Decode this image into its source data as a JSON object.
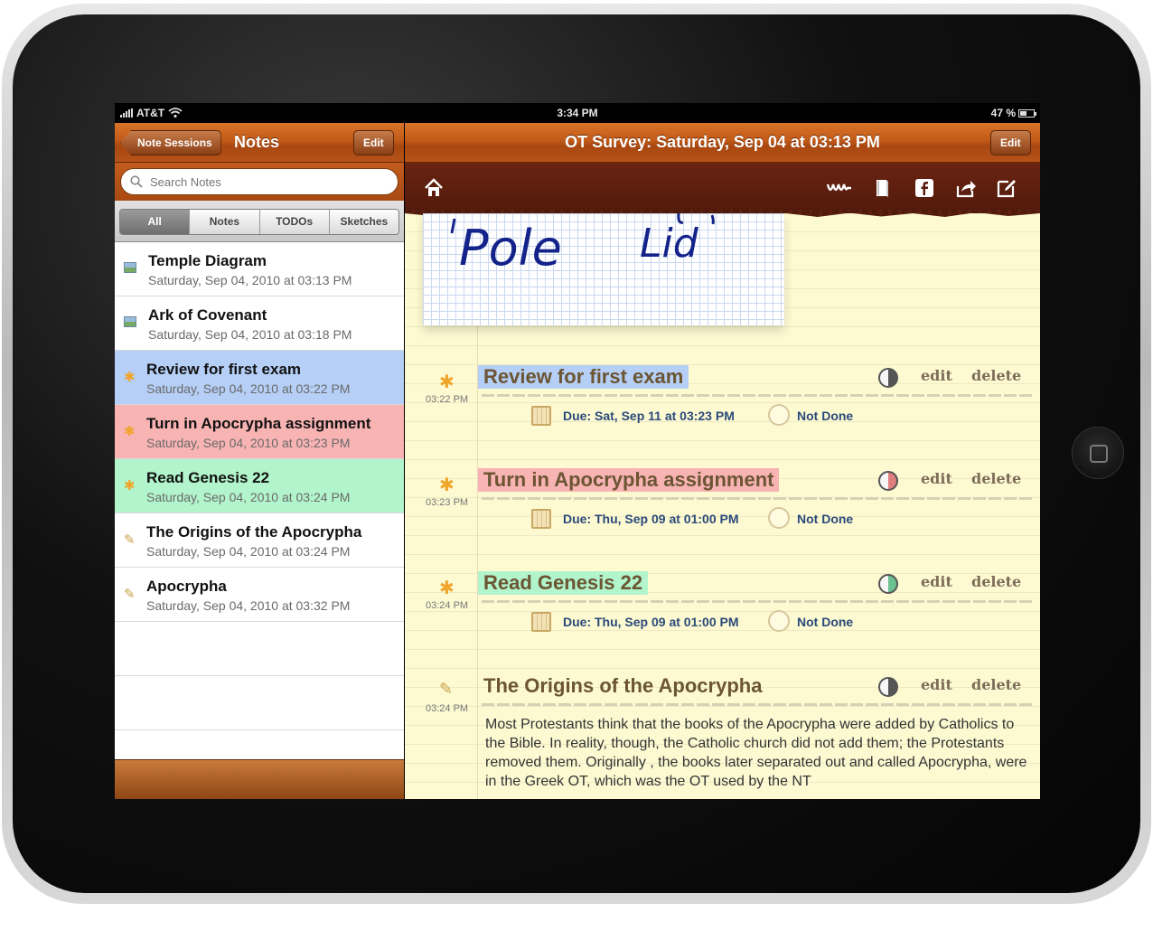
{
  "status_bar": {
    "carrier": "AT&T",
    "time": "3:34 PM",
    "battery": "47 %"
  },
  "sidebar": {
    "back_label": "Note Sessions",
    "title": "Notes",
    "edit_label": "Edit",
    "search_placeholder": "Search Notes",
    "segments": [
      "All",
      "Notes",
      "TODOs",
      "Sketches"
    ],
    "selected_segment": "All",
    "items": [
      {
        "title": "Temple Diagram",
        "date": "Saturday, Sep 04, 2010 at 03:13 PM",
        "icon": "sketch-icon",
        "color": ""
      },
      {
        "title": "Ark of Covenant",
        "date": "Saturday, Sep 04, 2010 at 03:18 PM",
        "icon": "sketch-icon",
        "color": ""
      },
      {
        "title": "Review for first exam",
        "date": "Saturday, Sep 04, 2010 at 03:22 PM",
        "icon": "todo-star-icon",
        "color": "#b5cff6"
      },
      {
        "title": "Turn in Apocrypha assignment",
        "date": "Saturday, Sep 04, 2010 at 03:23 PM",
        "icon": "todo-star-icon",
        "color": "#f8b3b3"
      },
      {
        "title": "Read Genesis 22",
        "date": "Saturday, Sep 04, 2010 at 03:24 PM",
        "icon": "todo-star-icon",
        "color": "#b2f4cb"
      },
      {
        "title": "The Origins of the Apocrypha",
        "date": "Saturday, Sep 04, 2010 at 03:24 PM",
        "icon": "pencil-icon",
        "color": ""
      },
      {
        "title": "Apocrypha",
        "date": "Saturday, Sep 04, 2010 at 03:32 PM",
        "icon": "pencil-icon",
        "color": ""
      }
    ]
  },
  "detail": {
    "title": "OT Survey: Saturday, Sep 04 at 03:13 PM",
    "edit_label": "Edit",
    "toolbar_icons": [
      "home-icon",
      "squiggle-icon",
      "book-icon",
      "facebook-icon",
      "share-icon",
      "compose-icon"
    ],
    "sketch_text": [
      "Pole",
      "Lid"
    ],
    "edit_action": "edit",
    "delete_action": "delete",
    "entries": [
      {
        "time": "03:22 PM",
        "title": "Review for first exam",
        "highlight": "#b5cff6",
        "due": "Due: Sat, Sep 11 at 03:23 PM",
        "status": "Not Done",
        "icon": "todo-star-icon"
      },
      {
        "time": "03:23 PM",
        "title": "Turn in Apocrypha assignment",
        "highlight": "#f8b3b3",
        "due": "Due: Thu, Sep 09 at 01:00 PM",
        "status": "Not Done",
        "icon": "todo-star-icon"
      },
      {
        "time": "03:24 PM",
        "title": "Read Genesis 22",
        "highlight": "#b2f4cb",
        "due": "Due: Thu, Sep 09 at 01:00 PM",
        "status": "Not Done",
        "icon": "todo-star-icon"
      },
      {
        "time": "03:24 PM",
        "title": "The Origins of the Apocrypha",
        "highlight": "",
        "icon": "pencil-icon",
        "body": "Most Protestants think that the books of the Apocrypha were added by Catholics to the Bible. In reality, though, the Catholic church did not add them; the Protestants removed them. Originally , the books later separated out and called Apocrypha, were in the Greek OT, which was the OT used by the NT"
      }
    ]
  }
}
